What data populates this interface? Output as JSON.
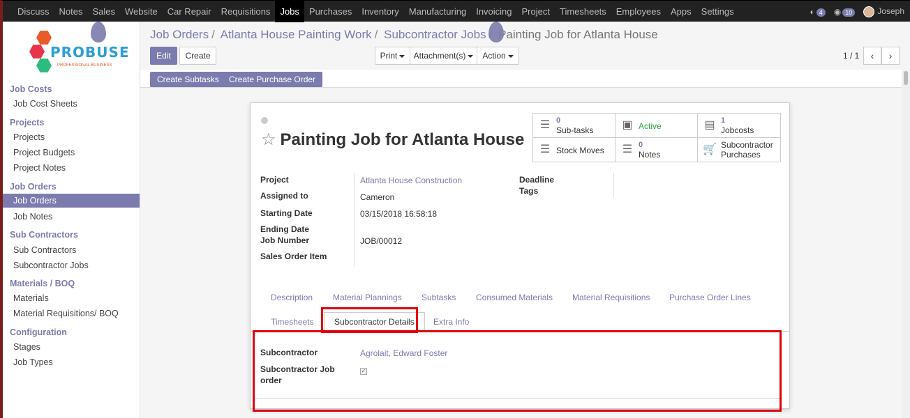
{
  "topnav": {
    "items": [
      "Discuss",
      "Notes",
      "Sales",
      "Website",
      "Car Repair",
      "Requisitions",
      "Jobs",
      "Purchases",
      "Inventory",
      "Manufacturing",
      "Invoicing",
      "Project",
      "Timesheets",
      "Employees",
      "Apps",
      "Settings"
    ],
    "active": "Jobs",
    "chat_count": "4",
    "activity_count": "10",
    "user": "Joseph"
  },
  "logo": {
    "brand": "PROBUSE",
    "tagline": "PROFESSIONAL BUSINESS"
  },
  "sidebar": {
    "sections": [
      {
        "title": "Job Costs",
        "items": [
          "Job Cost Sheets"
        ]
      },
      {
        "title": "Projects",
        "items": [
          "Projects",
          "Project Budgets",
          "Project Notes"
        ]
      },
      {
        "title": "Job Orders",
        "items": [
          "Job Orders",
          "Job Notes"
        ]
      },
      {
        "title": "Sub Contractors",
        "items": [
          "Sub Contractors",
          "Subcontractor Jobs"
        ]
      },
      {
        "title": "Materials / BOQ",
        "items": [
          "Materials",
          "Material Requisitions/ BOQ"
        ]
      },
      {
        "title": "Configuration",
        "items": [
          "Stages",
          "Job Types"
        ]
      }
    ],
    "active_item": "Job Orders"
  },
  "breadcrumb": {
    "items": [
      "Job Orders",
      "Atlanta House Painting Work",
      "Subcontractor Jobs"
    ],
    "current": "Painting Job for Atlanta House"
  },
  "controls": {
    "edit": "Edit",
    "create": "Create",
    "print": "Print",
    "attachments": "Attachment(s)",
    "action": "Action",
    "pager": "1 / 1"
  },
  "action_buttons": {
    "create_subtasks": "Create Subtasks",
    "create_po": "Create Purchase Order"
  },
  "record": {
    "title": "Painting Job for Atlanta House",
    "stats": {
      "subtasks": {
        "count": "0",
        "label": "Sub-tasks"
      },
      "active": "Active",
      "jobcosts": {
        "count": "1",
        "label": "Jobcosts"
      },
      "stock_moves": "Stock Moves",
      "notes": {
        "count": "0",
        "label": "Notes"
      },
      "subcontractor_purchases": "Subcontractor Purchases"
    },
    "fields": {
      "project_label": "Project",
      "project": "Atlanta House Construction",
      "assigned_label": "Assigned to",
      "assigned": "Cameron",
      "start_label": "Starting Date",
      "start": "03/15/2018 16:58:18",
      "end_label": "Ending Date",
      "jobnum_label": "Job Number",
      "jobnum": "JOB/00012",
      "soi_label": "Sales Order Item",
      "deadline_label": "Deadline",
      "tags_label": "Tags"
    },
    "tabs": [
      "Description",
      "Material Plannings",
      "Subtasks",
      "Consumed Materials",
      "Material Requisitions",
      "Purchase Order Lines",
      "Timesheets",
      "Subcontractor Details",
      "Extra Info"
    ],
    "active_tab": "Subcontractor Details",
    "subcontractor": {
      "label": "Subcontractor",
      "value": "Agrolait, Edward Foster",
      "job_order_label": "Subcontractor Job order",
      "job_order_checked": true
    }
  },
  "colors": {
    "accent": "#7c7bad",
    "highlight": "#e0000c",
    "topbar": "#222222"
  }
}
